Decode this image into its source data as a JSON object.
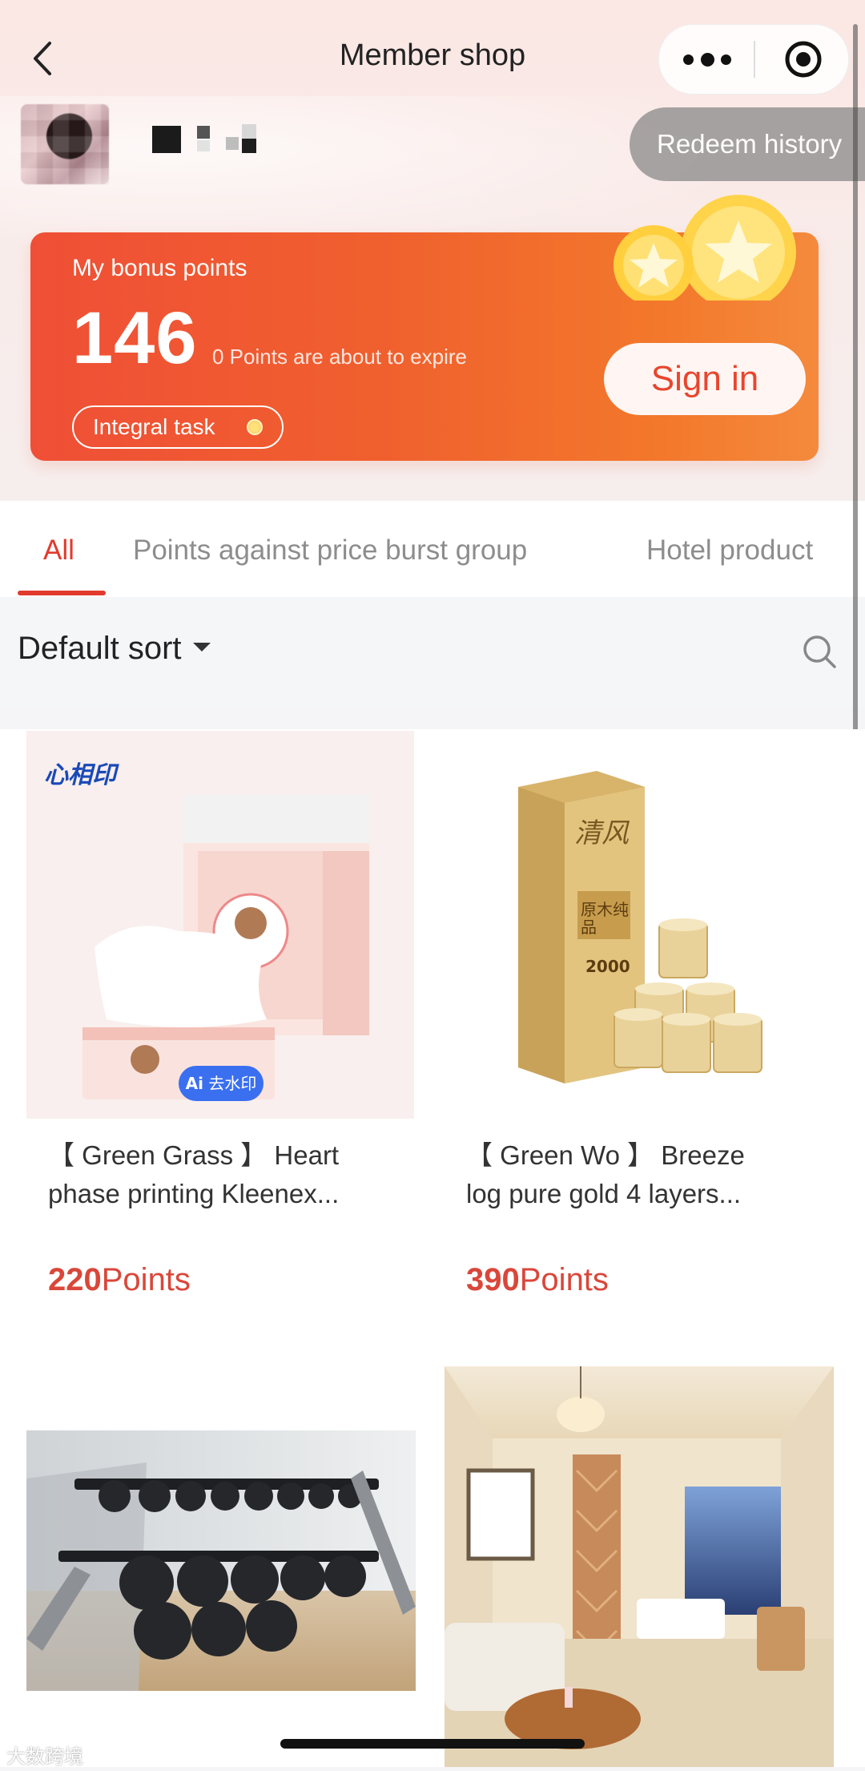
{
  "nav": {
    "title": "Member shop",
    "back_icon": "chevron-left-icon",
    "more_icon": "more-dots-icon",
    "record_icon": "target-icon"
  },
  "header": {
    "redeem_label": "Redeem history"
  },
  "points_card": {
    "label": "My bonus points",
    "points": "146",
    "expire_text": "0 Points are about to expire",
    "task_label": "Integral task",
    "sign_label": "Sign in"
  },
  "tabs": [
    {
      "label": "All",
      "active": true
    },
    {
      "label": "Points against price burst group",
      "active": false
    },
    {
      "label": "Hotel product",
      "active": false
    }
  ],
  "sort": {
    "label": "Default sort"
  },
  "products": [
    {
      "line1": "【 Green Grass 】  Heart",
      "line2": "phase printing Kleenex...",
      "points_value": "220",
      "points_unit": "Points",
      "logo_text": "心相印",
      "badge_text": "去水印",
      "badge_ai": "Ai"
    },
    {
      "line1": "【 Green Wo 】  Breeze",
      "line2": "log pure gold 4 layers...",
      "points_value": "390",
      "points_unit": "Points",
      "pack_text": "清风",
      "pack_sub": "原木纯品",
      "pack_num": "2000"
    },
    {
      "image": "dumbbell-rack"
    },
    {
      "image": "hotel-room"
    }
  ],
  "watermark": "大数跨境",
  "colors": {
    "accent": "#e13b2e",
    "card_start": "#ef4f36",
    "card_end": "#f48a3d",
    "price": "#d9473a"
  }
}
